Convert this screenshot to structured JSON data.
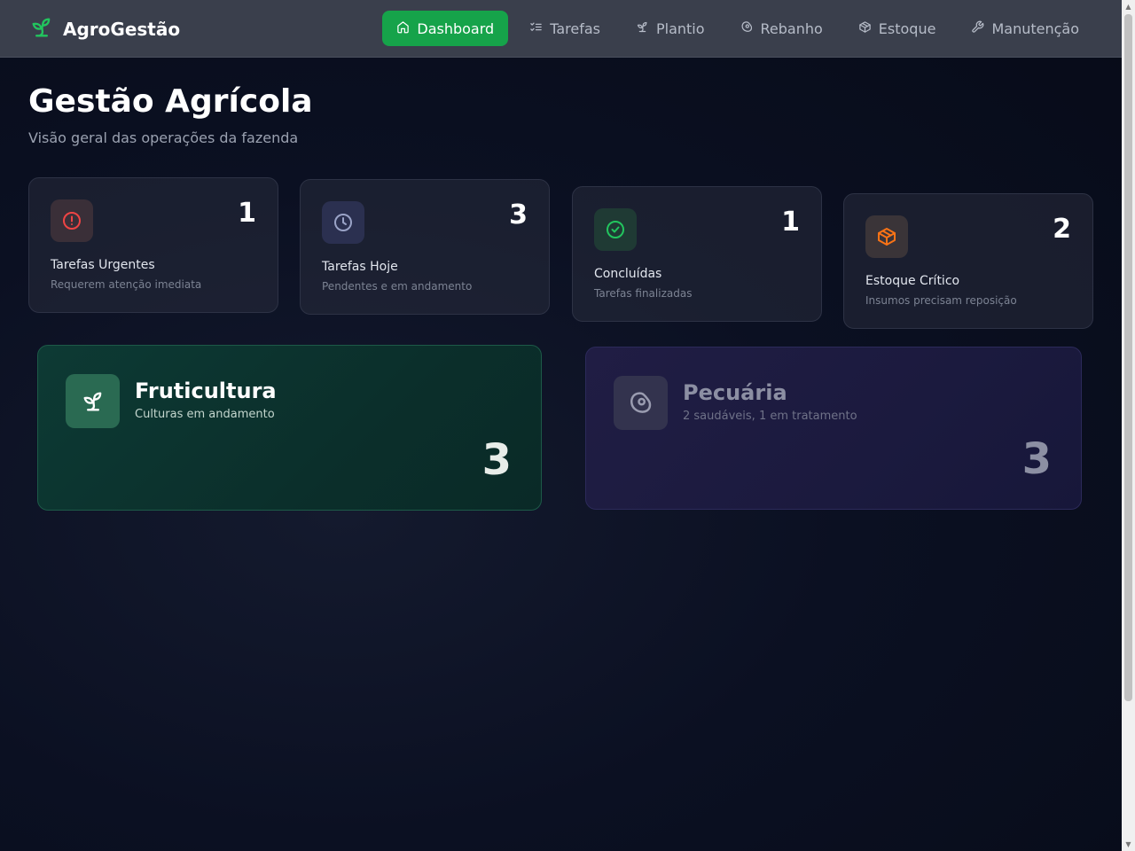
{
  "brand": {
    "name": "AgroGestão",
    "color": "#22c55e"
  },
  "nav": [
    {
      "label": "Dashboard",
      "icon": "home-icon",
      "active": true
    },
    {
      "label": "Tarefas",
      "icon": "list-check-icon",
      "active": false
    },
    {
      "label": "Plantio",
      "icon": "sprout-icon",
      "active": false
    },
    {
      "label": "Rebanho",
      "icon": "meat-icon",
      "active": false
    },
    {
      "label": "Estoque",
      "icon": "box-icon",
      "active": false
    },
    {
      "label": "Manutenção",
      "icon": "wrench-icon",
      "active": false
    }
  ],
  "header": {
    "title": "Gestão Agrícola",
    "subtitle": "Visão geral das operações da fazenda"
  },
  "stats": [
    {
      "label": "Tarefas Urgentes",
      "description": "Requerem atenção imediata",
      "value": "1",
      "icon": "alert-circle-icon",
      "color": "#ef4444"
    },
    {
      "label": "Tarefas Hoje",
      "description": "Pendentes e em andamento",
      "value": "3",
      "icon": "clock-icon",
      "color": "#9aa3c7"
    },
    {
      "label": "Concluídas",
      "description": "Tarefas finalizadas",
      "value": "1",
      "icon": "check-circle-icon",
      "color": "#22c55e"
    },
    {
      "label": "Estoque Crítico",
      "description": "Insumos precisam reposição",
      "value": "2",
      "icon": "box-icon",
      "color": "#f97316"
    }
  ],
  "categories": [
    {
      "title": "Fruticultura",
      "subtitle": "Culturas em andamento",
      "value": "3",
      "icon": "sprout-icon",
      "color": "#ffffff"
    },
    {
      "title": "Pecuária",
      "subtitle": "2 saudáveis, 1 em tratamento",
      "value": "3",
      "icon": "meat-icon",
      "color": "#8c8fa3"
    }
  ]
}
